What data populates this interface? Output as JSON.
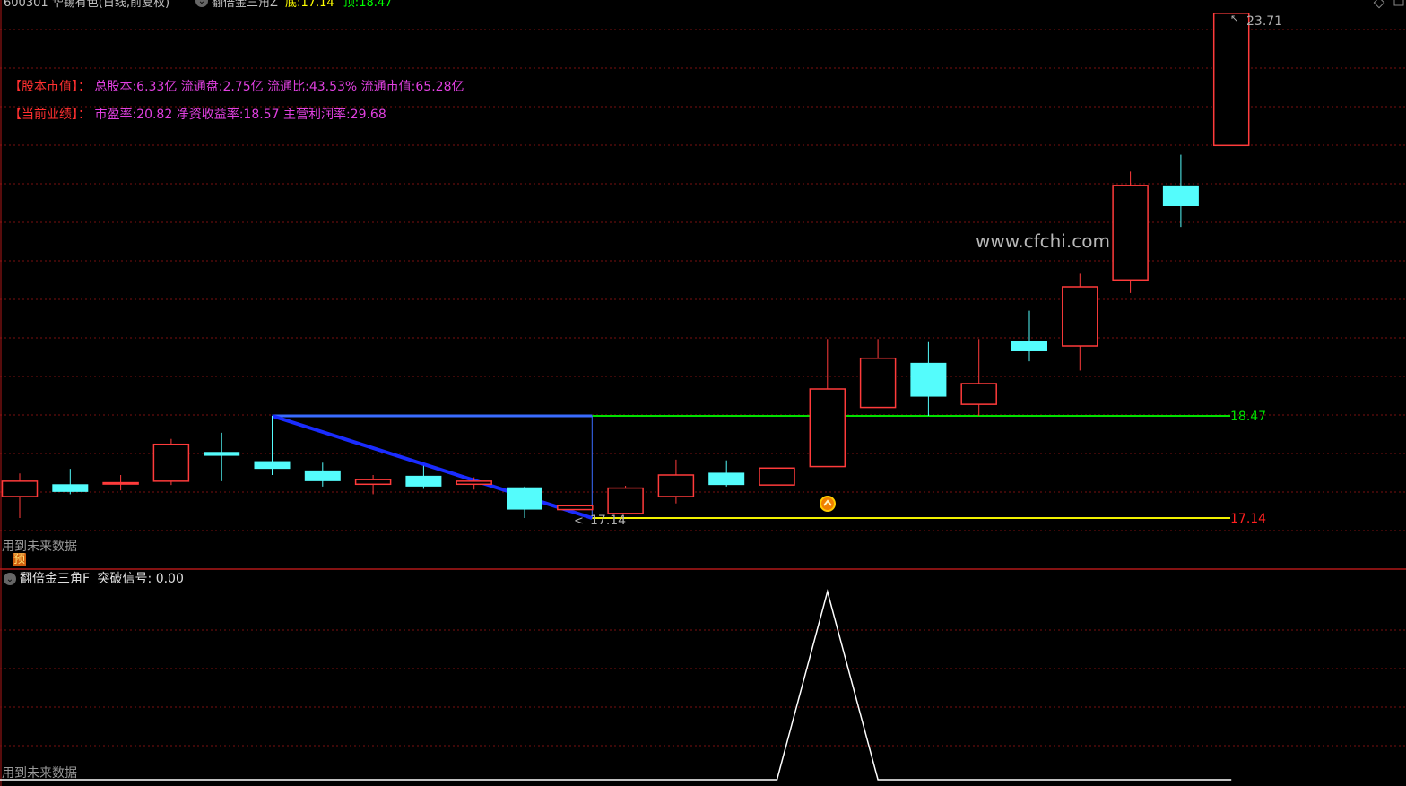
{
  "header": {
    "stock": "600301 华锡有色(日线,前复权)",
    "indicator": "翻倍金三角Z",
    "low_label": "底:",
    "low_value": "17.14",
    "high_label": "顶:",
    "high_value": "18.47"
  },
  "info": {
    "line1_label": "【股本市值】：",
    "line1_text": "总股本:6.33亿 流通盘:2.75亿 流通比:43.53% 流通市值:65.28亿",
    "line2_label": "【当前业绩】：",
    "line2_text": "市盈率:20.82 净资收益率:18.57 主营利润率:29.68"
  },
  "watermark": "www.cfchi.com",
  "future_data_note": "用到未来数据",
  "pre_badge": "预",
  "lower_panel": {
    "title": "翻倍金三角F",
    "signal_label": "突破信号:",
    "signal_value": "0.00",
    "future_data_note": "用到未来数据"
  },
  "levels": {
    "top": "18.47",
    "bottom": "17.14",
    "bottom_marker": "17.14",
    "max_marker": "23.71"
  },
  "colors": {
    "up": "#ff3b3b",
    "down": "#54fcfc",
    "top_line": "#00e000",
    "bottom_line": "#f0f000",
    "triangle": "#1a2cff",
    "grid": "#7a1010"
  },
  "chart_data": {
    "type": "candlestick",
    "y_range": [
      16.8,
      23.9
    ],
    "candles": [
      {
        "o": 17.42,
        "c": 17.62,
        "h": 17.72,
        "l": 17.14
      },
      {
        "o": 17.58,
        "c": 17.48,
        "h": 17.78,
        "l": 17.45
      },
      {
        "o": 17.6,
        "c": 17.6,
        "h": 17.7,
        "l": 17.5
      },
      {
        "o": 17.62,
        "c": 18.1,
        "h": 18.17,
        "l": 17.57
      },
      {
        "o": 18.0,
        "c": 17.95,
        "h": 18.25,
        "l": 17.62
      },
      {
        "o": 17.88,
        "c": 17.78,
        "h": 18.47,
        "l": 17.7
      },
      {
        "o": 17.76,
        "c": 17.62,
        "h": 17.86,
        "l": 17.55
      },
      {
        "o": 17.58,
        "c": 17.64,
        "h": 17.7,
        "l": 17.45
      },
      {
        "o": 17.69,
        "c": 17.55,
        "h": 17.82,
        "l": 17.52
      },
      {
        "o": 17.58,
        "c": 17.62,
        "h": 17.67,
        "l": 17.51
      },
      {
        "o": 17.54,
        "c": 17.25,
        "h": 17.55,
        "l": 17.14
      },
      {
        "o": 17.25,
        "c": 17.3,
        "h": 17.3,
        "l": 17.25
      },
      {
        "o": 17.2,
        "c": 17.53,
        "h": 17.56,
        "l": 17.2
      },
      {
        "o": 17.42,
        "c": 17.7,
        "h": 17.9,
        "l": 17.33
      },
      {
        "o": 17.73,
        "c": 17.57,
        "h": 17.89,
        "l": 17.55
      },
      {
        "o": 17.57,
        "c": 17.79,
        "h": 17.79,
        "l": 17.45
      },
      {
        "o": 17.81,
        "c": 18.82,
        "h": 19.47,
        "l": 17.81
      },
      {
        "o": 18.58,
        "c": 19.22,
        "h": 19.47,
        "l": 18.58
      },
      {
        "o": 19.16,
        "c": 18.72,
        "h": 19.43,
        "l": 18.47
      },
      {
        "o": 18.62,
        "c": 18.89,
        "h": 19.47,
        "l": 18.47
      },
      {
        "o": 19.44,
        "c": 19.31,
        "h": 19.84,
        "l": 19.18
      },
      {
        "o": 19.38,
        "c": 20.15,
        "h": 20.32,
        "l": 19.06
      },
      {
        "o": 20.24,
        "c": 21.47,
        "h": 21.65,
        "l": 20.07
      },
      {
        "o": 21.47,
        "c": 21.2,
        "h": 21.87,
        "l": 20.93
      },
      {
        "o": 21.99,
        "c": 23.71,
        "h": 23.71,
        "l": 21.99
      }
    ],
    "signal": {
      "values": [
        0,
        0,
        0,
        0,
        0,
        0,
        0,
        0,
        0,
        0,
        0,
        0,
        0,
        0,
        0,
        0,
        1,
        0,
        0,
        0,
        0,
        0,
        0,
        0,
        0
      ]
    }
  }
}
